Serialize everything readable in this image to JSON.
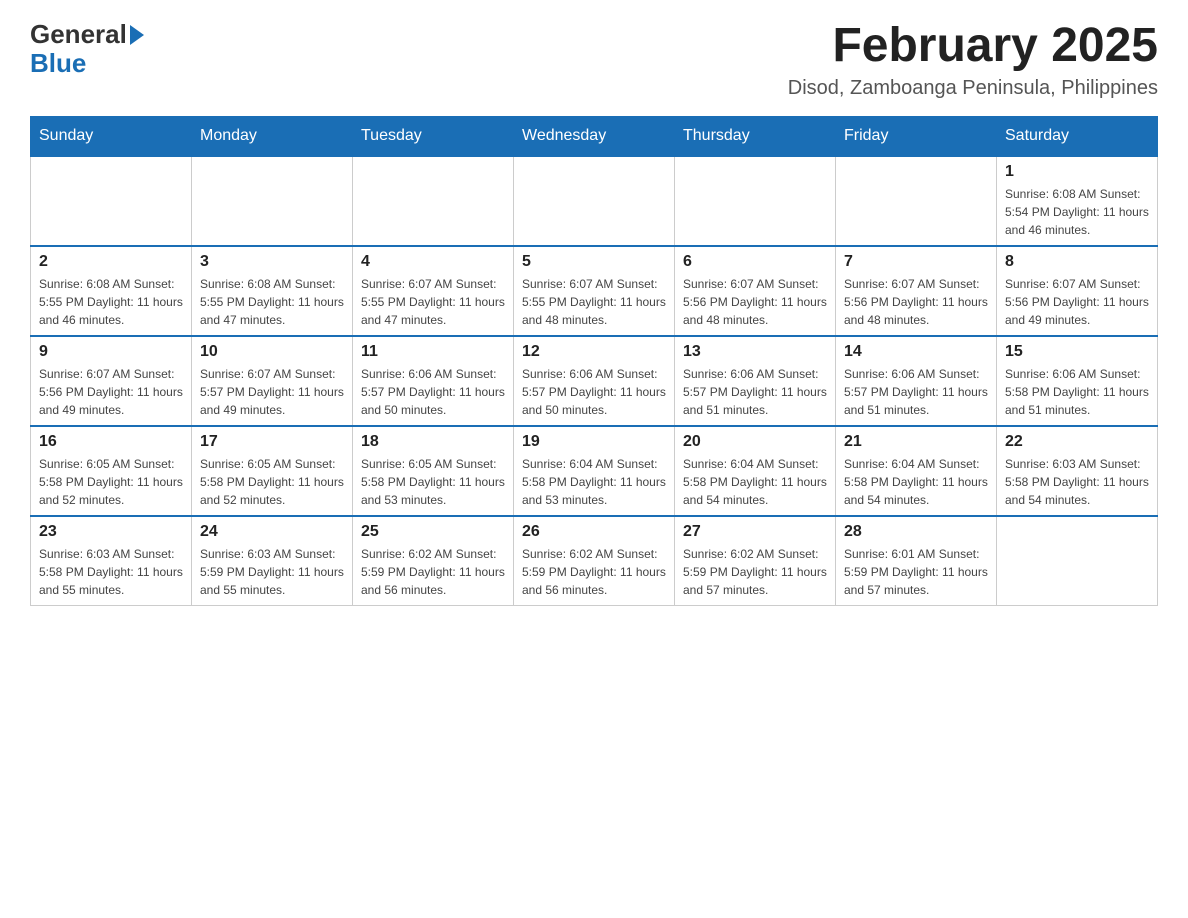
{
  "header": {
    "title": "February 2025",
    "subtitle": "Disod, Zamboanga Peninsula, Philippines",
    "logo_general": "General",
    "logo_blue": "Blue"
  },
  "days_of_week": [
    "Sunday",
    "Monday",
    "Tuesday",
    "Wednesday",
    "Thursday",
    "Friday",
    "Saturday"
  ],
  "weeks": [
    [
      {
        "day": "",
        "info": ""
      },
      {
        "day": "",
        "info": ""
      },
      {
        "day": "",
        "info": ""
      },
      {
        "day": "",
        "info": ""
      },
      {
        "day": "",
        "info": ""
      },
      {
        "day": "",
        "info": ""
      },
      {
        "day": "1",
        "info": "Sunrise: 6:08 AM\nSunset: 5:54 PM\nDaylight: 11 hours and 46 minutes."
      }
    ],
    [
      {
        "day": "2",
        "info": "Sunrise: 6:08 AM\nSunset: 5:55 PM\nDaylight: 11 hours and 46 minutes."
      },
      {
        "day": "3",
        "info": "Sunrise: 6:08 AM\nSunset: 5:55 PM\nDaylight: 11 hours and 47 minutes."
      },
      {
        "day": "4",
        "info": "Sunrise: 6:07 AM\nSunset: 5:55 PM\nDaylight: 11 hours and 47 minutes."
      },
      {
        "day": "5",
        "info": "Sunrise: 6:07 AM\nSunset: 5:55 PM\nDaylight: 11 hours and 48 minutes."
      },
      {
        "day": "6",
        "info": "Sunrise: 6:07 AM\nSunset: 5:56 PM\nDaylight: 11 hours and 48 minutes."
      },
      {
        "day": "7",
        "info": "Sunrise: 6:07 AM\nSunset: 5:56 PM\nDaylight: 11 hours and 48 minutes."
      },
      {
        "day": "8",
        "info": "Sunrise: 6:07 AM\nSunset: 5:56 PM\nDaylight: 11 hours and 49 minutes."
      }
    ],
    [
      {
        "day": "9",
        "info": "Sunrise: 6:07 AM\nSunset: 5:56 PM\nDaylight: 11 hours and 49 minutes."
      },
      {
        "day": "10",
        "info": "Sunrise: 6:07 AM\nSunset: 5:57 PM\nDaylight: 11 hours and 49 minutes."
      },
      {
        "day": "11",
        "info": "Sunrise: 6:06 AM\nSunset: 5:57 PM\nDaylight: 11 hours and 50 minutes."
      },
      {
        "day": "12",
        "info": "Sunrise: 6:06 AM\nSunset: 5:57 PM\nDaylight: 11 hours and 50 minutes."
      },
      {
        "day": "13",
        "info": "Sunrise: 6:06 AM\nSunset: 5:57 PM\nDaylight: 11 hours and 51 minutes."
      },
      {
        "day": "14",
        "info": "Sunrise: 6:06 AM\nSunset: 5:57 PM\nDaylight: 11 hours and 51 minutes."
      },
      {
        "day": "15",
        "info": "Sunrise: 6:06 AM\nSunset: 5:58 PM\nDaylight: 11 hours and 51 minutes."
      }
    ],
    [
      {
        "day": "16",
        "info": "Sunrise: 6:05 AM\nSunset: 5:58 PM\nDaylight: 11 hours and 52 minutes."
      },
      {
        "day": "17",
        "info": "Sunrise: 6:05 AM\nSunset: 5:58 PM\nDaylight: 11 hours and 52 minutes."
      },
      {
        "day": "18",
        "info": "Sunrise: 6:05 AM\nSunset: 5:58 PM\nDaylight: 11 hours and 53 minutes."
      },
      {
        "day": "19",
        "info": "Sunrise: 6:04 AM\nSunset: 5:58 PM\nDaylight: 11 hours and 53 minutes."
      },
      {
        "day": "20",
        "info": "Sunrise: 6:04 AM\nSunset: 5:58 PM\nDaylight: 11 hours and 54 minutes."
      },
      {
        "day": "21",
        "info": "Sunrise: 6:04 AM\nSunset: 5:58 PM\nDaylight: 11 hours and 54 minutes."
      },
      {
        "day": "22",
        "info": "Sunrise: 6:03 AM\nSunset: 5:58 PM\nDaylight: 11 hours and 54 minutes."
      }
    ],
    [
      {
        "day": "23",
        "info": "Sunrise: 6:03 AM\nSunset: 5:58 PM\nDaylight: 11 hours and 55 minutes."
      },
      {
        "day": "24",
        "info": "Sunrise: 6:03 AM\nSunset: 5:59 PM\nDaylight: 11 hours and 55 minutes."
      },
      {
        "day": "25",
        "info": "Sunrise: 6:02 AM\nSunset: 5:59 PM\nDaylight: 11 hours and 56 minutes."
      },
      {
        "day": "26",
        "info": "Sunrise: 6:02 AM\nSunset: 5:59 PM\nDaylight: 11 hours and 56 minutes."
      },
      {
        "day": "27",
        "info": "Sunrise: 6:02 AM\nSunset: 5:59 PM\nDaylight: 11 hours and 57 minutes."
      },
      {
        "day": "28",
        "info": "Sunrise: 6:01 AM\nSunset: 5:59 PM\nDaylight: 11 hours and 57 minutes."
      },
      {
        "day": "",
        "info": ""
      }
    ]
  ]
}
